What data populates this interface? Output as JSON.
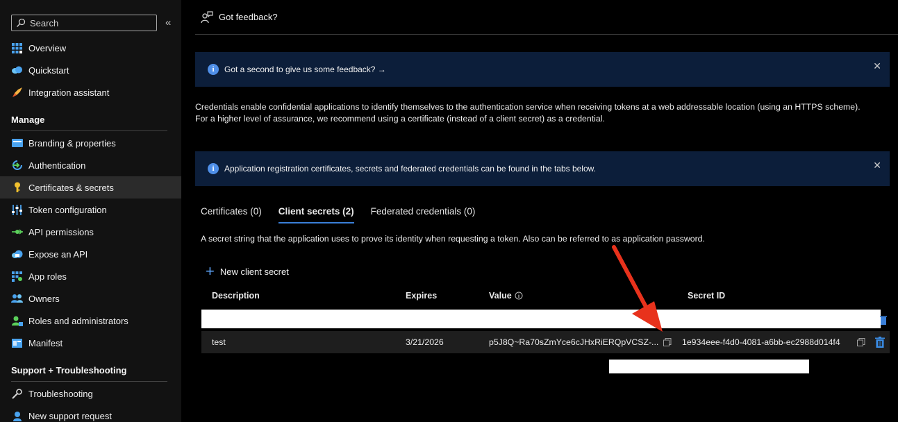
{
  "sidebar": {
    "search_placeholder": "Search",
    "collapse_icon": "«",
    "top_items": [
      {
        "label": "Overview",
        "icon": "grid-icon"
      },
      {
        "label": "Quickstart",
        "icon": "cloud-icon"
      },
      {
        "label": "Integration assistant",
        "icon": "rocket-icon"
      }
    ],
    "manage_header": "Manage",
    "manage_items": [
      {
        "label": "Branding & properties",
        "icon": "card-icon"
      },
      {
        "label": "Authentication",
        "icon": "auth-icon"
      },
      {
        "label": "Certificates & secrets",
        "icon": "key-icon",
        "active": true
      },
      {
        "label": "Token configuration",
        "icon": "sliders-icon"
      },
      {
        "label": "API permissions",
        "icon": "permissions-icon"
      },
      {
        "label": "Expose an API",
        "icon": "cloud-api-icon"
      },
      {
        "label": "App roles",
        "icon": "app-roles-icon"
      },
      {
        "label": "Owners",
        "icon": "owners-icon"
      },
      {
        "label": "Roles and administrators",
        "icon": "roles-icon"
      },
      {
        "label": "Manifest",
        "icon": "manifest-icon"
      }
    ],
    "support_header": "Support + Troubleshooting",
    "support_items": [
      {
        "label": "Troubleshooting",
        "icon": "wrench-icon"
      },
      {
        "label": "New support request",
        "icon": "support-icon"
      }
    ]
  },
  "topbar": {
    "feedback_label": "Got feedback?"
  },
  "banner_feedback": {
    "text": "Got a second to give us some feedback? →"
  },
  "description": "Credentials enable confidential applications to identify themselves to the authentication service when receiving tokens at a web addressable location (using an HTTPS scheme). For a higher level of assurance, we recommend using a certificate (instead of a client secret) as a credential.",
  "banner_info": {
    "text": "Application registration certificates, secrets and federated credentials can be found in the tabs below."
  },
  "tabs": [
    {
      "label": "Certificates (0)"
    },
    {
      "label": "Client secrets (2)",
      "active": true
    },
    {
      "label": "Federated credentials (0)"
    }
  ],
  "secret_description": "A secret string that the application uses to prove its identity when requesting a token. Also can be referred to as application password.",
  "new_secret_label": "New client secret",
  "table": {
    "headers": {
      "description": "Description",
      "expires": "Expires",
      "value": "Value",
      "secret_id": "Secret ID"
    },
    "row": {
      "description": "test",
      "expires": "3/21/2026",
      "value": "p5J8Q~Ra70sZmYce6cJHxRiERQpVCSZ-...",
      "secret_id": "1e934eee-f4d0-4081-a6bb-ec2988d014f4"
    }
  },
  "colors": {
    "accent": "#3a7fd8",
    "banner_bg": "#0c1e3a",
    "arrow": "#e8321c"
  }
}
